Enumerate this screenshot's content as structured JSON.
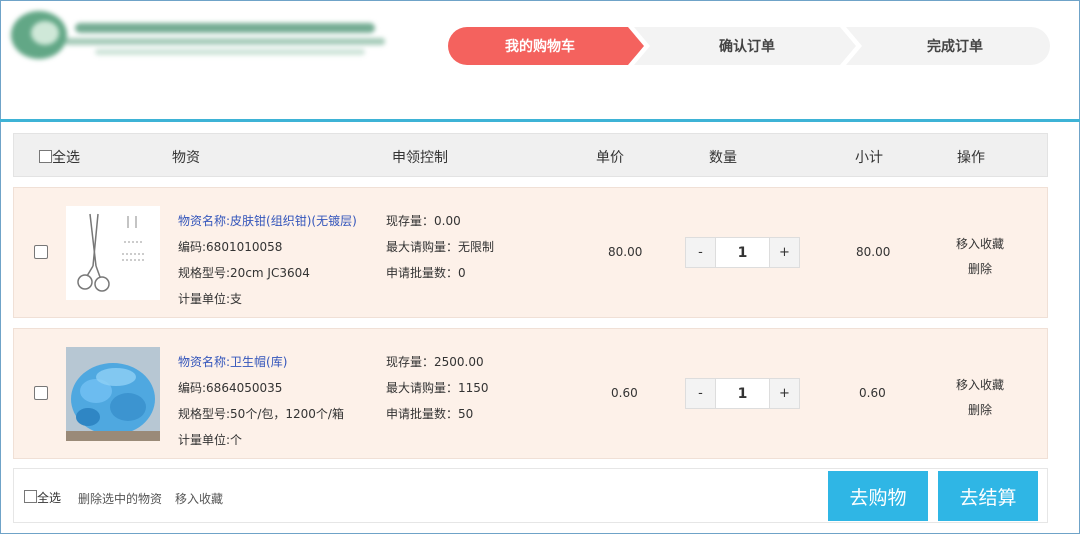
{
  "steps": [
    "我的购物车",
    "确认订单",
    "完成订单"
  ],
  "colors": {
    "active_step": "#f4625e",
    "accent": "#2fb6e5",
    "row_bg": "#fdf1e9"
  },
  "table_header": {
    "select_all": "全选",
    "goods": "物资",
    "control": "申领控制",
    "unit_price": "单价",
    "quantity": "数量",
    "subtotal": "小计",
    "actions": "操作"
  },
  "items": [
    {
      "image": "forceps-icon",
      "name": "物资名称:皮肤钳(组织钳)(无镀层)",
      "code": "编码:6801010058",
      "spec": "规格型号:20cm JC3604",
      "unit": "计量单位:支",
      "stock": "现存量：0.00",
      "max_qty": "最大请购量：无限制",
      "batch": "申请批量数：0",
      "price": "80.00",
      "quantity": "1",
      "subtotal": "80.00",
      "op_fav": "移入收藏",
      "op_delete": "删除"
    },
    {
      "image": "cap-pack-icon",
      "name": "物资名称:卫生帽(库)",
      "code": "编码:6864050035",
      "spec": "规格型号:50个/包，1200个/箱",
      "unit": "计量单位:个",
      "stock": "现存量：2500.00",
      "max_qty": "最大请购量：1150",
      "batch": "申请批量数：50",
      "price": "0.60",
      "quantity": "1",
      "subtotal": "0.60",
      "op_fav": "移入收藏",
      "op_delete": "删除"
    }
  ],
  "qty_minus": "-",
  "qty_plus": "+",
  "footer": {
    "select_all": "全选",
    "delete_selected": "删除选中的物资",
    "move_fav": "移入收藏",
    "go_shopping": "去购物",
    "checkout": "去结算"
  }
}
